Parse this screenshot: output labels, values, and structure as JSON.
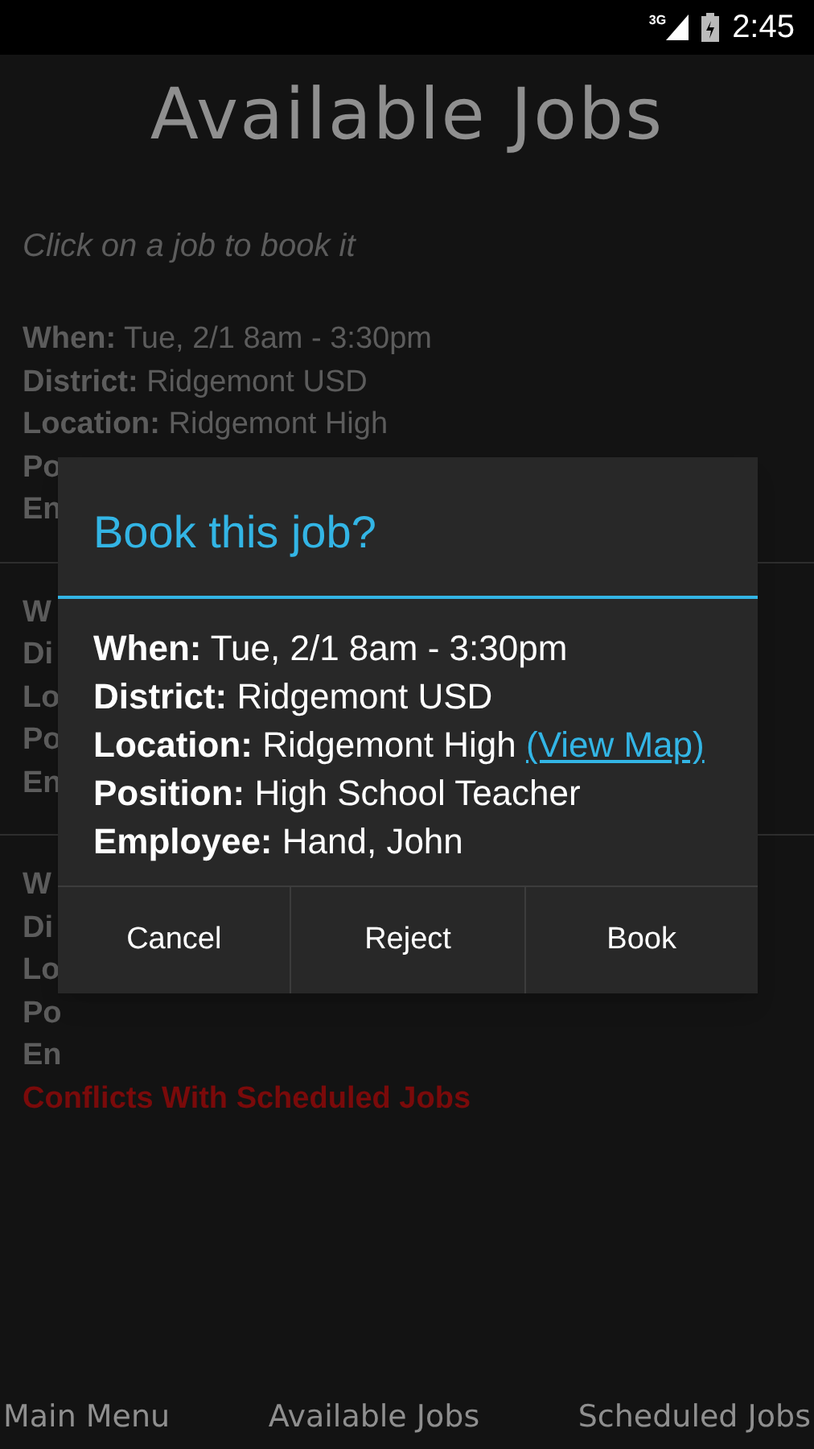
{
  "status_bar": {
    "network": "3G",
    "time": "2:45"
  },
  "title": "Available Jobs",
  "hint": "Click on a job to book it",
  "jobs": [
    {
      "lines": [
        {
          "kind": "detail",
          "label": "When:",
          "value": "Tue, 2/1 8am - 3:30pm"
        },
        {
          "kind": "detail",
          "label": "District:",
          "value": "Ridgemont USD"
        },
        {
          "kind": "detail",
          "label": "Location:",
          "value": "Ridgemont High"
        },
        {
          "kind": "detail",
          "label": "Po"
        },
        {
          "kind": "detail",
          "label": "En"
        }
      ]
    },
    {
      "lines": [
        {
          "kind": "detail",
          "label": "W"
        },
        {
          "kind": "detail",
          "label": "Di"
        },
        {
          "kind": "detail",
          "label": "Lo"
        },
        {
          "kind": "detail",
          "label": "Po"
        },
        {
          "kind": "detail",
          "label": "En"
        }
      ]
    },
    {
      "lines": [
        {
          "kind": "detail",
          "label": "W"
        },
        {
          "kind": "detail",
          "label": "Di"
        },
        {
          "kind": "detail",
          "label": "Lo"
        },
        {
          "kind": "detail",
          "label": "Po"
        },
        {
          "kind": "detail",
          "label": "En"
        },
        {
          "kind": "warning",
          "label": "Conflicts With Scheduled Jobs"
        }
      ]
    }
  ],
  "dialog": {
    "title": "Book this job?",
    "lines": [
      {
        "label": "When:",
        "value": "Tue, 2/1 8am - 3:30pm"
      },
      {
        "label": "District:",
        "value": "Ridgemont USD"
      },
      {
        "label": "Location:",
        "value": "Ridgemont High",
        "link": "(View Map)"
      },
      {
        "label": "Position:",
        "value": "High School Teacher"
      },
      {
        "label": "Employee:",
        "value": "Hand, John"
      }
    ],
    "buttons": [
      "Cancel",
      "Reject",
      "Book"
    ]
  },
  "nav": [
    "Main Menu",
    "Available Jobs",
    "Scheduled Jobs"
  ]
}
